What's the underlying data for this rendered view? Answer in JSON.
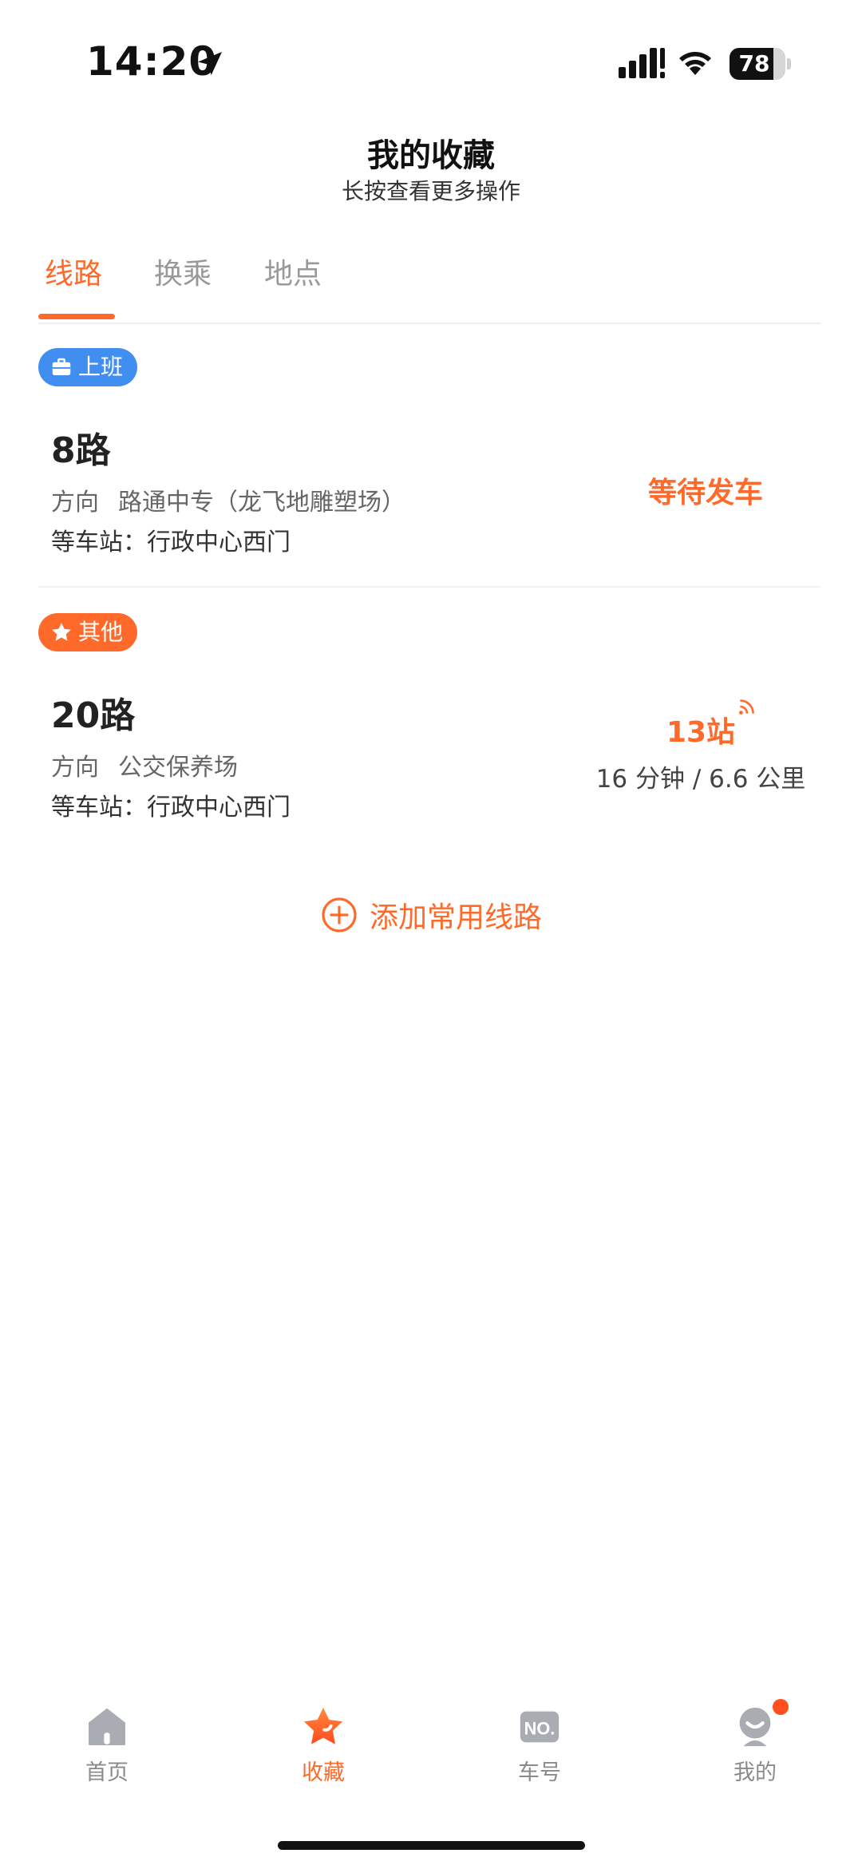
{
  "status_bar": {
    "time": "14:20",
    "battery": "78",
    "battery_level": 0.78
  },
  "header": {
    "title": "我的收藏",
    "subtitle": "长按查看更多操作"
  },
  "tabs": [
    {
      "label": "线路",
      "active": true
    },
    {
      "label": "换乘",
      "active": false
    },
    {
      "label": "地点",
      "active": false
    }
  ],
  "routes": [
    {
      "tag": "上班",
      "tag_icon": "briefcase-icon",
      "tag_color": "#3f8ef0",
      "name": "8路",
      "direction_label": "方向",
      "direction": "路通中专（龙飞地雕塑场）",
      "stop": "等车站：行政中心西门",
      "status": "等待发车"
    },
    {
      "tag": "其他",
      "tag_icon": "star-icon",
      "tag_color": "#ff6a2a",
      "name": "20路",
      "direction_label": "方向",
      "direction": "公交保养场",
      "stop": "等车站：行政中心西门",
      "stops_away": "13站",
      "eta": "16 分钟 / 6.6 公里"
    }
  ],
  "add_route_label": "添加常用线路",
  "accent_color": "#ff6a2a",
  "bottom_nav": [
    {
      "label": "首页",
      "icon": "home-icon",
      "active": false
    },
    {
      "label": "收藏",
      "icon": "star-icon",
      "active": true
    },
    {
      "label": "车号",
      "icon": "bus-number-icon",
      "active": false
    },
    {
      "label": "我的",
      "icon": "profile-icon",
      "active": false,
      "badge": true
    }
  ]
}
